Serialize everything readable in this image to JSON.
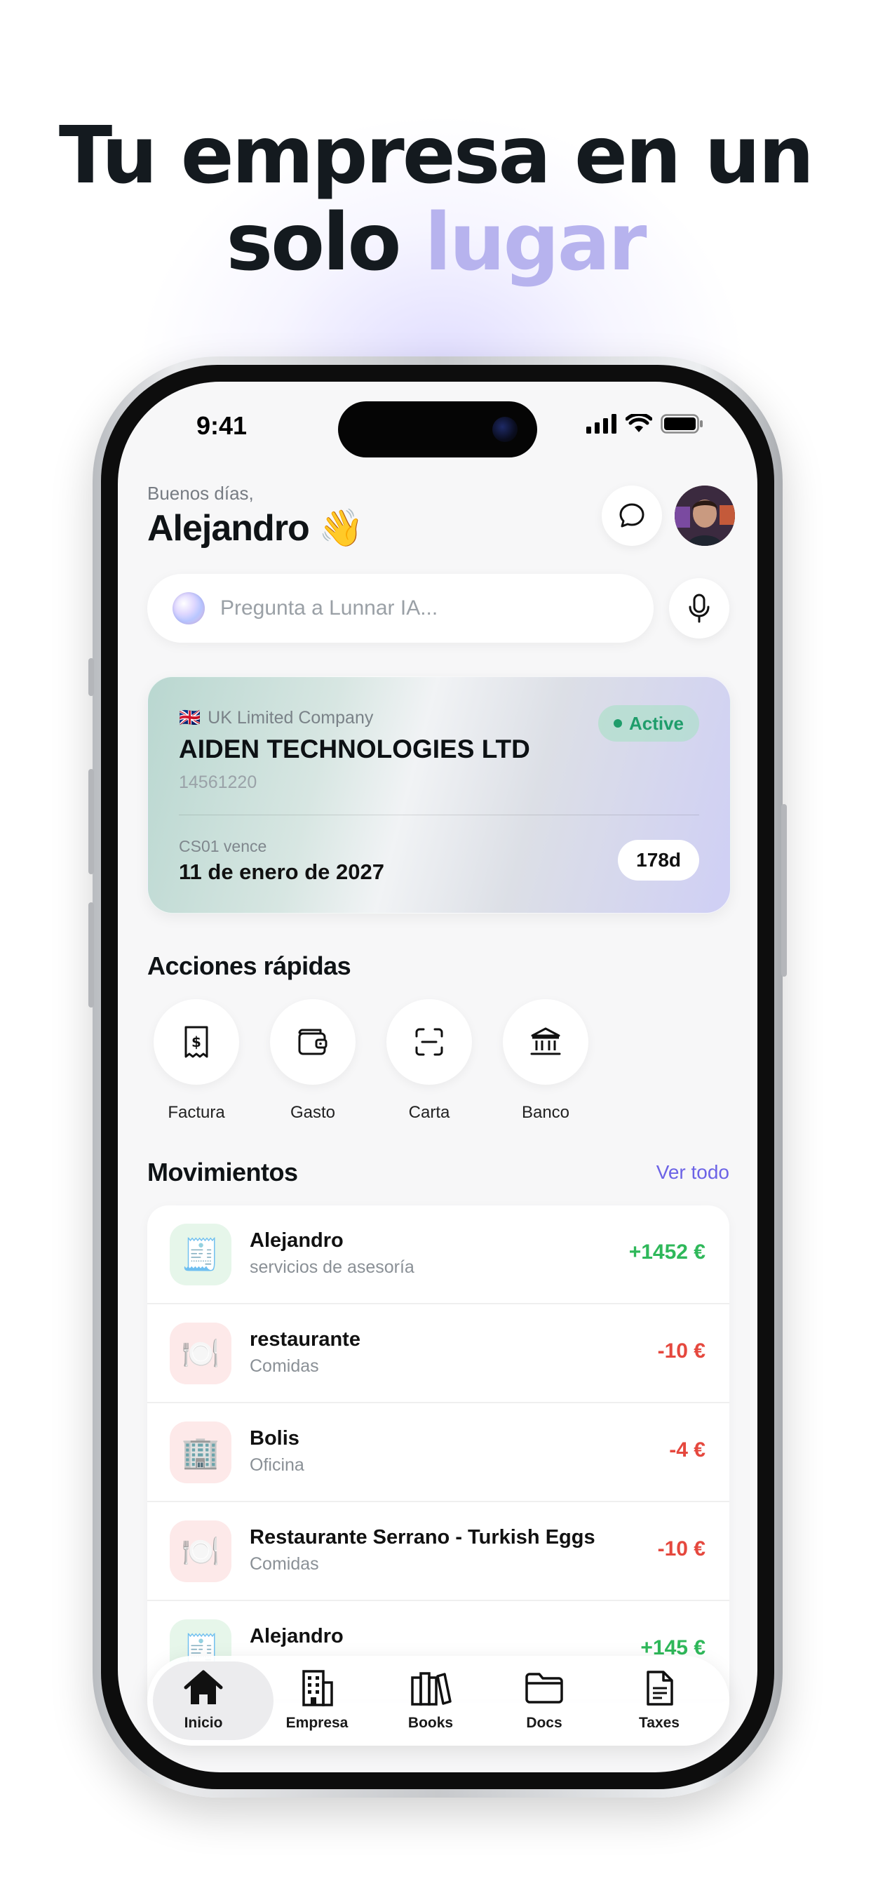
{
  "headline": {
    "line1": "Tu empresa en un",
    "line2_plain": "solo ",
    "line2_accent": "lugar"
  },
  "status_bar": {
    "time": "9:41"
  },
  "greeting": {
    "small": "Buenos días,",
    "name": "Alejandro",
    "emoji": "👋"
  },
  "search": {
    "placeholder": "Pregunta a Lunnar IA..."
  },
  "company_card": {
    "flag": "🇬🇧",
    "type": "UK Limited Company",
    "name": "AIDEN TECHNOLOGIES LTD",
    "number": "14561220",
    "status": "Active",
    "expiry_label": "CS01 vence",
    "expiry_date": "11 de enero de 2027",
    "days_left": "178d"
  },
  "quick_actions": {
    "title": "Acciones rápidas",
    "items": [
      {
        "label": "Factura",
        "icon": "invoice-icon"
      },
      {
        "label": "Gasto",
        "icon": "wallet-icon"
      },
      {
        "label": "Carta",
        "icon": "scan-icon"
      },
      {
        "label": "Banco",
        "icon": "bank-icon"
      }
    ]
  },
  "movements": {
    "title": "Movimientos",
    "see_all": "Ver todo",
    "items": [
      {
        "title": "Alejandro",
        "subtitle": "servicios de asesoría",
        "amount": "+1452 €",
        "icon": "receipt-emoji",
        "emoji": "🧾",
        "tint": "#e6f6ea",
        "type": "income"
      },
      {
        "title": "restaurante",
        "subtitle": "Comidas",
        "amount": "-10 €",
        "icon": "plate-emoji",
        "emoji": "🍽️",
        "tint": "#fde9e9",
        "type": "expense"
      },
      {
        "title": "Bolis",
        "subtitle": "Oficina",
        "amount": "-4 €",
        "icon": "office-building-emoji",
        "emoji": "🏢",
        "tint": "#fde9e9",
        "type": "expense"
      },
      {
        "title": "Restaurante Serrano - Turkish Eggs",
        "subtitle": "Comidas",
        "amount": "-10 €",
        "icon": "plate-emoji",
        "emoji": "🍽️",
        "tint": "#fde9e9",
        "type": "expense"
      },
      {
        "title": "Alejandro",
        "subtitle": "",
        "amount": "+145 €",
        "icon": "receipt-emoji",
        "emoji": "🧾",
        "tint": "#e6f6ea",
        "type": "income"
      }
    ]
  },
  "tab_bar": {
    "items": [
      {
        "label": "Inicio",
        "icon": "home-icon",
        "active": true
      },
      {
        "label": "Empresa",
        "icon": "building-icon",
        "active": false
      },
      {
        "label": "Books",
        "icon": "books-icon",
        "active": false
      },
      {
        "label": "Docs",
        "icon": "folder-icon",
        "active": false
      },
      {
        "label": "Taxes",
        "icon": "document-icon",
        "active": false
      }
    ]
  },
  "colors": {
    "accent": "#6c63e6",
    "headline_accent": "#b7b3ee",
    "positive": "#2fb85a",
    "negative": "#e5483e",
    "active_badge": "#1f9d6b"
  }
}
